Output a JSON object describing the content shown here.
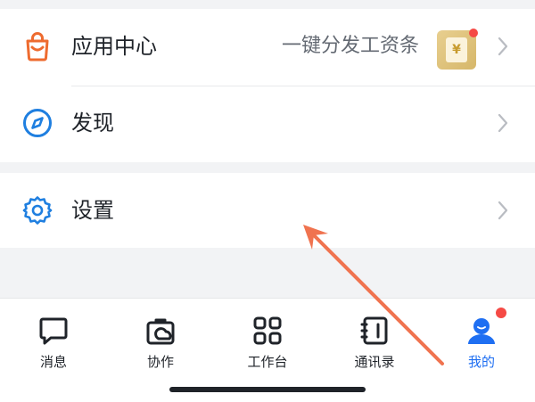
{
  "menu": {
    "app_center": {
      "label": "应用中心",
      "subtext": "一键分发工资条",
      "badge_glyph": "¥",
      "icon": "shopping-bag-icon",
      "color": "#ee6b2f"
    },
    "discover": {
      "label": "发现",
      "icon": "compass-icon",
      "color": "#1f7fe0"
    },
    "settings": {
      "label": "设置",
      "icon": "gear-icon",
      "color": "#1f7fe0"
    }
  },
  "tabbar": {
    "items": [
      {
        "label": "消息",
        "icon": "chat-bubble-icon"
      },
      {
        "label": "协作",
        "icon": "collaboration-icon"
      },
      {
        "label": "工作台",
        "icon": "grid-icon"
      },
      {
        "label": "通讯录",
        "icon": "contacts-book-icon"
      },
      {
        "label": "我的",
        "icon": "user-avatar-icon",
        "active": true,
        "has_dot": true
      }
    ]
  },
  "colors": {
    "accent": "#1f6ff2",
    "notification": "#f54a45",
    "annotation_arrow": "#f0734f"
  }
}
